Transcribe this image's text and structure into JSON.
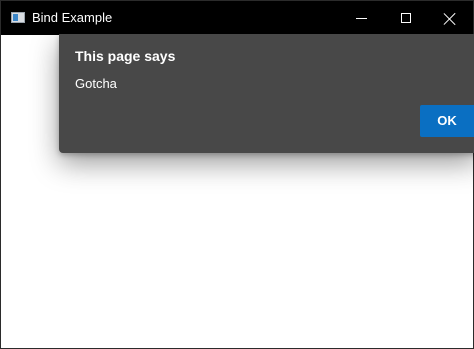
{
  "window": {
    "title": "Bind Example",
    "controls": {
      "minimize": "minimize-icon",
      "maximize": "maximize-icon",
      "close": "close-icon"
    }
  },
  "dialog": {
    "title": "This page says",
    "message": "Gotcha",
    "ok_label": "OK"
  },
  "colors": {
    "titlebar": "#000000",
    "dialog_background": "#484848",
    "accent": "#0a6fc2",
    "content_background": "#ffffff"
  }
}
